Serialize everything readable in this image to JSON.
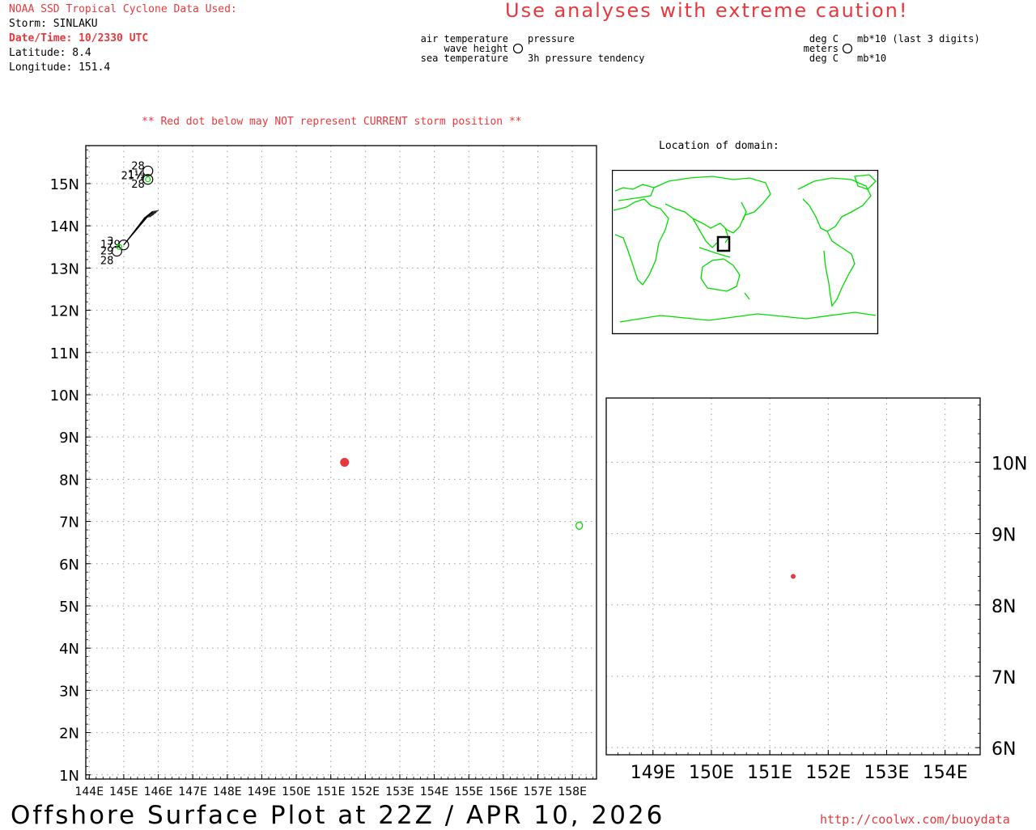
{
  "header": {
    "source": "NOAA SSD Tropical Cyclone Data Used:",
    "storm": "Storm: SINLAKU",
    "datetime": "Date/Time: 10/2330 UTC",
    "latitude": "Latitude: 8.4",
    "longitude": "Longitude: 151.4"
  },
  "warning": "Use analyses with extreme caution!",
  "legend": {
    "left": {
      "top_left": "air temperature",
      "top_right": "pressure",
      "mid_left": "wave height",
      "bottom_left": "sea temperature",
      "bottom_right": "3h pressure tendency"
    },
    "right": {
      "top_left": "deg C",
      "top_right": "mb*10 (last 3 digits)",
      "mid_left": "meters",
      "bottom_left": "deg C",
      "bottom_right": "mb*10"
    }
  },
  "red_dot_note": "** Red dot below may NOT represent CURRENT storm position **",
  "location_title": "Location of domain:",
  "footer": {
    "title": "Offshore Surface Plot at 22Z / APR 10, 2026",
    "url": "http://coolwx.com/buoydata"
  },
  "colors": {
    "storm": "#e8383d",
    "coast": "#00dd00",
    "grid": "#9a9a9a",
    "header_red": "#e8383d"
  },
  "chart_data": [
    {
      "type": "scatter",
      "name": "main-plot",
      "xlim": [
        143.9,
        158.7
      ],
      "ylim": [
        0.9,
        15.9
      ],
      "x_ticks": [
        144,
        145,
        146,
        147,
        148,
        149,
        150,
        151,
        152,
        153,
        154,
        155,
        156,
        157,
        158
      ],
      "x_tick_labels": [
        "144E",
        "145E",
        "146E",
        "147E",
        "148E",
        "149E",
        "150E",
        "151E",
        "152E",
        "153E",
        "154E",
        "155E",
        "156E",
        "157E",
        "158E"
      ],
      "y_ticks": [
        1,
        2,
        3,
        4,
        5,
        6,
        7,
        8,
        9,
        10,
        11,
        12,
        13,
        14,
        15
      ],
      "y_tick_labels": [
        "1N",
        "2N",
        "3N",
        "4N",
        "5N",
        "6N",
        "7N",
        "8N",
        "9N",
        "10N",
        "11N",
        "12N",
        "13N",
        "14N",
        "15N"
      ],
      "grid": true,
      "storm_position": {
        "lon": 151.4,
        "lat": 8.4
      },
      "stations": [
        {
          "lon": 145.7,
          "lat": 15.3,
          "labels": [
            "28",
            "21½"
          ]
        },
        {
          "lon": 145.7,
          "lat": 15.1,
          "labels": [
            "1½",
            "28"
          ]
        },
        {
          "lon": 144.8,
          "lat": 13.4,
          "labels": [
            "3",
            "29",
            "28"
          ]
        },
        {
          "lon": 145.0,
          "lat": 13.55,
          "labels": [
            "179"
          ]
        }
      ],
      "island": {
        "lon": 158.2,
        "lat": 6.9
      }
    },
    {
      "type": "scatter",
      "name": "zoom-plot",
      "xlim": [
        148.2,
        154.6
      ],
      "ylim": [
        5.9,
        10.9
      ],
      "x_ticks": [
        149,
        150,
        151,
        152,
        153,
        154
      ],
      "x_tick_labels": [
        "149E",
        "150E",
        "151E",
        "152E",
        "153E",
        "154E"
      ],
      "y_ticks": [
        6,
        7,
        8,
        9,
        10
      ],
      "y_tick_labels": [
        "6N",
        "7N",
        "8N",
        "9N",
        "10N"
      ],
      "grid": true,
      "storm_position": {
        "lon": 151.4,
        "lat": 8.4
      }
    }
  ]
}
